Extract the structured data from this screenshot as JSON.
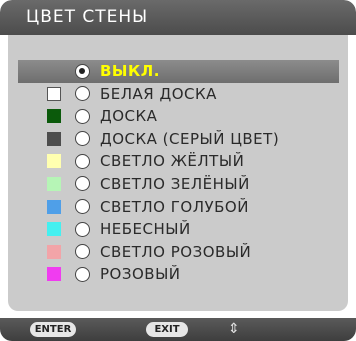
{
  "title": "ЦВЕТ СТЕНЫ",
  "options": [
    {
      "label": "ВЫКЛ.",
      "swatch": null,
      "selected": true,
      "outlined": false
    },
    {
      "label": "БЕЛАЯ ДОСКА",
      "swatch": "#ffffff",
      "selected": false,
      "outlined": true
    },
    {
      "label": "ДОСКА",
      "swatch": "#0b5a0b",
      "selected": false,
      "outlined": false
    },
    {
      "label": "ДОСКА (СЕРЫЙ ЦВЕТ)",
      "swatch": "#4d4d4d",
      "selected": false,
      "outlined": false
    },
    {
      "label": "СВЕТЛО ЖЁЛТЫЙ",
      "swatch": "#ffffb0",
      "selected": false,
      "outlined": false
    },
    {
      "label": "СВЕТЛО ЗЕЛЁНЫЙ",
      "swatch": "#b6f5b6",
      "selected": false,
      "outlined": false
    },
    {
      "label": "СВЕТЛО ГОЛУБОЙ",
      "swatch": "#4f9fe8",
      "selected": false,
      "outlined": false
    },
    {
      "label": "НЕБЕСНЫЙ",
      "swatch": "#44f0f0",
      "selected": false,
      "outlined": false
    },
    {
      "label": "СВЕТЛО РОЗОВЫЙ",
      "swatch": "#f2a4a8",
      "selected": false,
      "outlined": false
    },
    {
      "label": "РОЗОВЫЙ",
      "swatch": "#f03cf0",
      "selected": false,
      "outlined": false
    }
  ],
  "footer": {
    "enter_label": "ENTER",
    "exit_label": "EXIT",
    "updown_icon": "up-down-arrows-icon"
  }
}
